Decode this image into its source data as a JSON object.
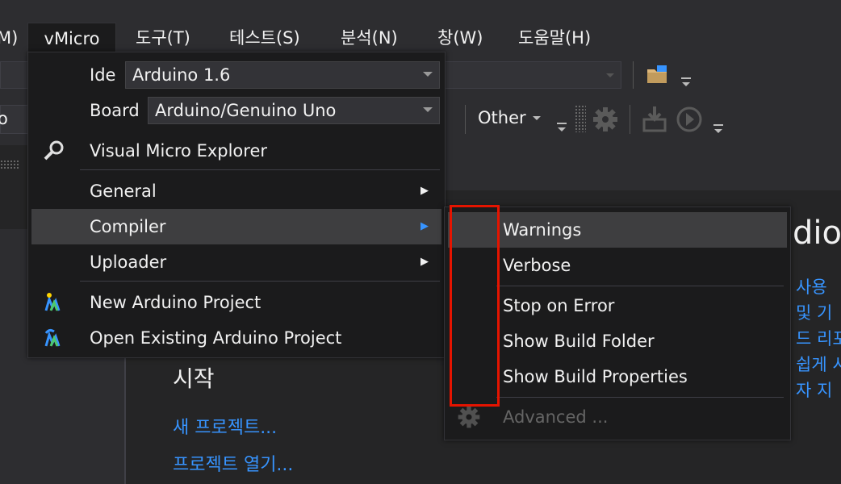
{
  "menubar": {
    "items": [
      {
        "label": "M)"
      },
      {
        "label": "vMicro"
      },
      {
        "label": "도구(T)"
      },
      {
        "label": "테스트(S)"
      },
      {
        "label": "분석(N)"
      },
      {
        "label": "창(W)"
      },
      {
        "label": "도움말(H)"
      }
    ]
  },
  "toolbar": {
    "left_fragment": "o",
    "other_label": "Other"
  },
  "vmicro_menu": {
    "ide_label": "Ide",
    "ide_value": "Arduino 1.6",
    "board_label": "Board",
    "board_value": "Arduino/Genuino Uno",
    "items": [
      {
        "label": "Visual Micro Explorer"
      },
      {
        "label": "General"
      },
      {
        "label": "Compiler"
      },
      {
        "label": "Uploader"
      },
      {
        "label": "New Arduino Project"
      },
      {
        "label": "Open Existing Arduino Project"
      }
    ]
  },
  "compiler_submenu": {
    "items": [
      {
        "label": "Warnings"
      },
      {
        "label": "Verbose"
      },
      {
        "label": "Stop on Error"
      },
      {
        "label": "Show Build Folder"
      },
      {
        "label": "Show Build Properties"
      },
      {
        "label": "Advanced ..."
      }
    ]
  },
  "start_page": {
    "title_fragment": "dio",
    "start_heading": "시작",
    "new_project": "새 프로젝트...",
    "open_project": "프로젝트 열기...",
    "right_lines": [
      "사용",
      "및 기",
      "드 리포",
      "쉽게 시",
      "자 지"
    ]
  }
}
